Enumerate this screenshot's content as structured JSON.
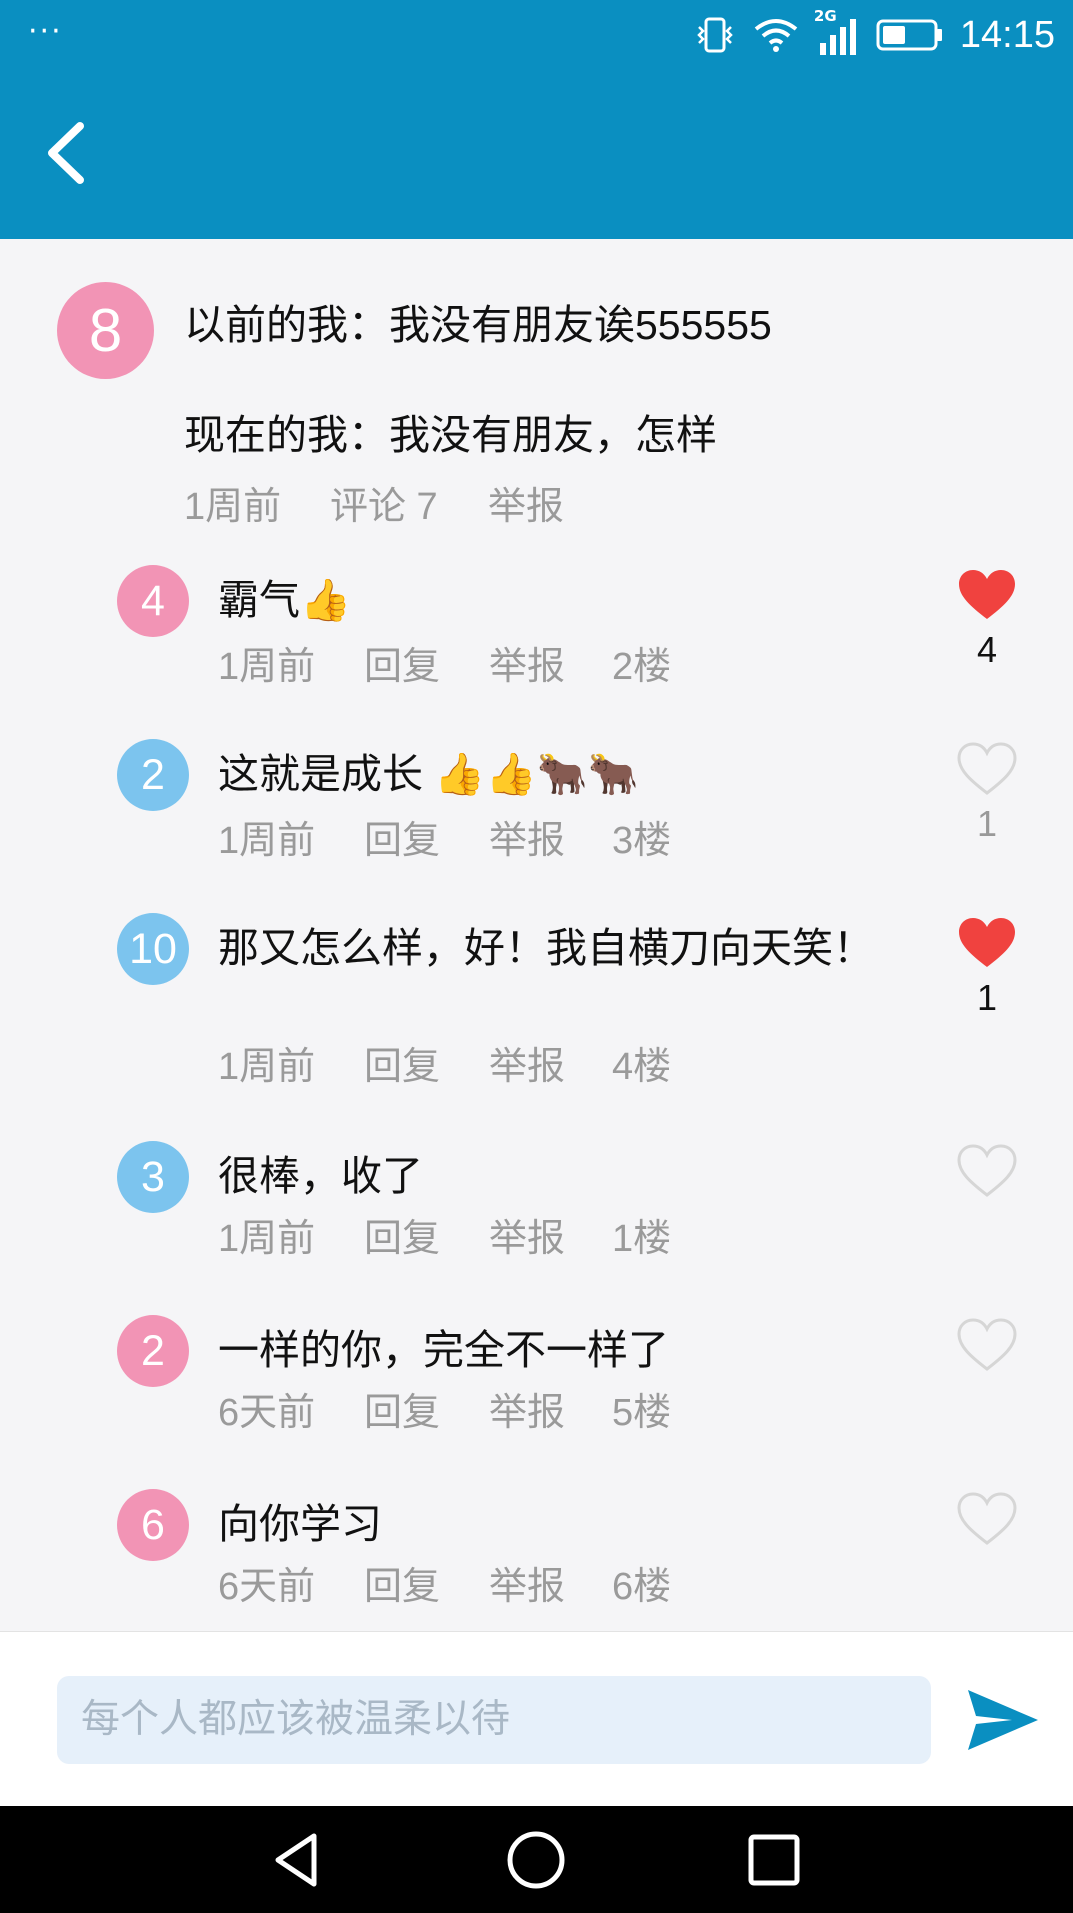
{
  "status_bar": {
    "dots": "···",
    "network": "2G",
    "time": "14:15"
  },
  "post": {
    "avatar_number": "8",
    "line1": "以前的我：我没有朋友诶555555",
    "line2": "现在的我：我没有朋友，怎样",
    "time": "1周前",
    "comments": "评论 7",
    "report": "举报"
  },
  "comments": [
    {
      "avatar": "4",
      "avatar_color": "pink",
      "text": "霸气👍",
      "time": "1周前",
      "reply": "回复",
      "report": "举报",
      "floor": "2楼",
      "liked": true,
      "likes": "4"
    },
    {
      "avatar": "2",
      "avatar_color": "blue",
      "text": "这就是成长 👍👍🐂🐂",
      "time": "1周前",
      "reply": "回复",
      "report": "举报",
      "floor": "3楼",
      "liked": false,
      "likes": "1"
    },
    {
      "avatar": "10",
      "avatar_color": "blue",
      "text": "那又怎么样，好！我自横刀向天笑！",
      "time": "1周前",
      "reply": "回复",
      "report": "举报",
      "floor": "4楼",
      "liked": true,
      "likes": "1"
    },
    {
      "avatar": "3",
      "avatar_color": "blue",
      "text": "很棒，收了",
      "time": "1周前",
      "reply": "回复",
      "report": "举报",
      "floor": "1楼",
      "liked": false,
      "likes": ""
    },
    {
      "avatar": "2",
      "avatar_color": "pink",
      "text": "一样的你，完全不一样了",
      "time": "6天前",
      "reply": "回复",
      "report": "举报",
      "floor": "5楼",
      "liked": false,
      "likes": ""
    },
    {
      "avatar": "6",
      "avatar_color": "pink",
      "text": "向你学习",
      "time": "6天前",
      "reply": "回复",
      "report": "举报",
      "floor": "6楼",
      "liked": false,
      "likes": ""
    }
  ],
  "input": {
    "placeholder": "每个人都应该被温柔以待"
  },
  "colors": {
    "primary": "#0a8fc1",
    "heart_liked": "#f0423f",
    "avatar_pink": "#f294b5",
    "avatar_blue": "#7cc4ee"
  },
  "icons": {
    "back": "chevron-left-icon",
    "send": "send-icon",
    "heart": "heart-icon",
    "nav_back": "triangle-back-icon",
    "nav_home": "circle-home-icon",
    "nav_recent": "square-recent-icon"
  }
}
